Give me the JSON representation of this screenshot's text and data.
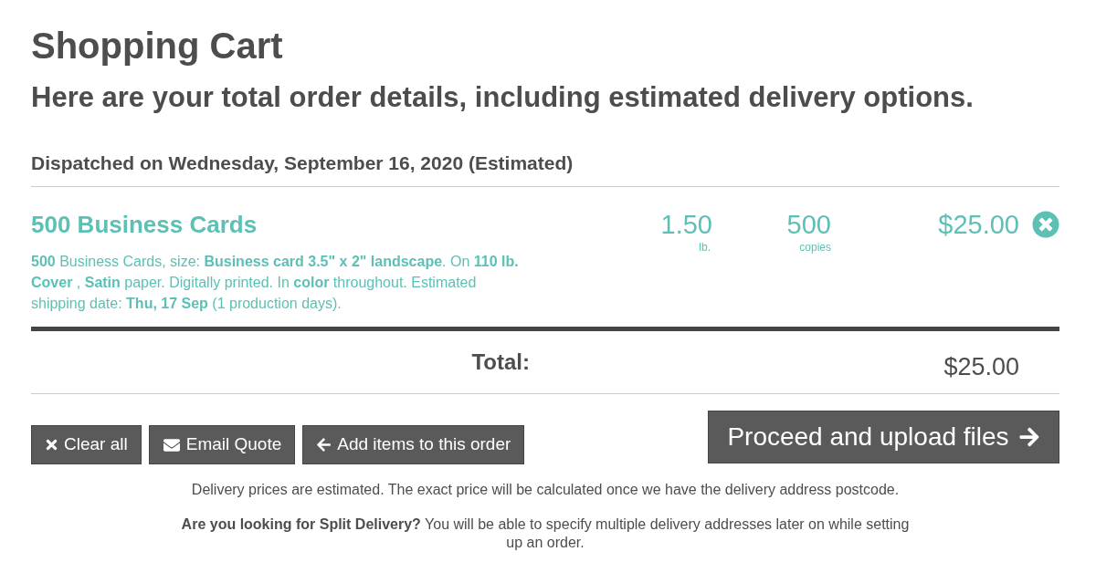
{
  "page": {
    "title": "Shopping Cart",
    "subtitle": "Here are your total order details, including estimated delivery options."
  },
  "dispatch_heading": "Dispatched on Wednesday, September 16, 2020 (Estimated)",
  "items": [
    {
      "name": "500 Business Cards",
      "description": "**500** Business Cards, size: **Business card 3.5\" x 2\" landscape**. On **110 lb. Cover** , **Satin** paper. Digitally printed. In **color** throughout. Estimated shipping date: **Thu, 17 Sep** (1 production days).",
      "weight": "1.50",
      "weight_unit": "lb.",
      "copies": "500",
      "copies_unit": "copies",
      "price": "$25.00"
    }
  ],
  "total": {
    "label": "Total:",
    "amount": "$25.00"
  },
  "actions": [
    {
      "kind": "clear",
      "label": "Clear all"
    },
    {
      "kind": "email",
      "label": "Email Quote"
    },
    {
      "kind": "add",
      "label": "Add items to this order"
    }
  ],
  "proceed": {
    "label": "Proceed and upload files"
  },
  "notes": [
    "Delivery prices are estimated. The exact price will be calculated once we have the delivery address postcode.",
    "**Are you looking for Split Delivery?** You will be able to specify multiple delivery addresses later on while setting up an order."
  ]
}
